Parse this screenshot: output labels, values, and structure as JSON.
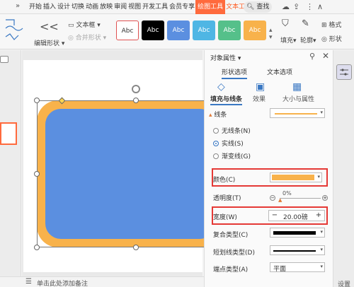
{
  "tabbar": {
    "tabs": [
      "开始",
      "插入",
      "设计",
      "切换",
      "动画",
      "放映",
      "审阅",
      "视图",
      "开发工具",
      "会员专享",
      "绘图工具",
      "文本工具"
    ],
    "active_tab": "绘图工具",
    "search_label": "查找",
    "chevron": "»"
  },
  "ribbon": {
    "edit_shape": "编辑形状",
    "text_box": "文本框",
    "merge_shape": "合并形状",
    "style_label": "Abc",
    "styles": [
      {
        "bg": "#ffffff",
        "border": "#e05252",
        "fg": "#333333"
      },
      {
        "bg": "#000000",
        "border": "#000000",
        "fg": "#ffffff"
      },
      {
        "bg": "#5b8fe0",
        "border": "#5b8fe0",
        "fg": "#ffffff"
      },
      {
        "bg": "#4fb6e4",
        "border": "#4fb6e4",
        "fg": "#ffffff"
      },
      {
        "bg": "#55c08a",
        "border": "#55c08a",
        "fg": "#ffffff"
      },
      {
        "bg": "#f8b24b",
        "border": "#f8b24b",
        "fg": "#ffffff"
      }
    ],
    "fill": "填充",
    "outline": "轮廓",
    "format": "格式",
    "shape_effect": "形状"
  },
  "canvas": {
    "status_text": "单击此处添加备注"
  },
  "panel": {
    "title": "对象属性",
    "tab_shape": "形状选项",
    "tab_text": "文本选项",
    "sub_fill": "填充与线条",
    "sub_effect": "效果",
    "sub_size": "大小与属性",
    "section_line": "线条",
    "radio_none": "无线条(N)",
    "radio_solid": "实线(S)",
    "radio_gradient": "渐变线(G)",
    "color_label": "颜色(C)",
    "color_value": "#f8b24b",
    "transparency_label": "透明度(T)",
    "transparency_value": "0%",
    "width_label": "宽度(W)",
    "width_value": "20.00磅",
    "compound_label": "复合类型(C)",
    "dash_label": "短划线类型(D)",
    "cap_label": "端点类型(A)",
    "cap_value": "平面"
  },
  "far_right": {
    "settings": "设置"
  }
}
